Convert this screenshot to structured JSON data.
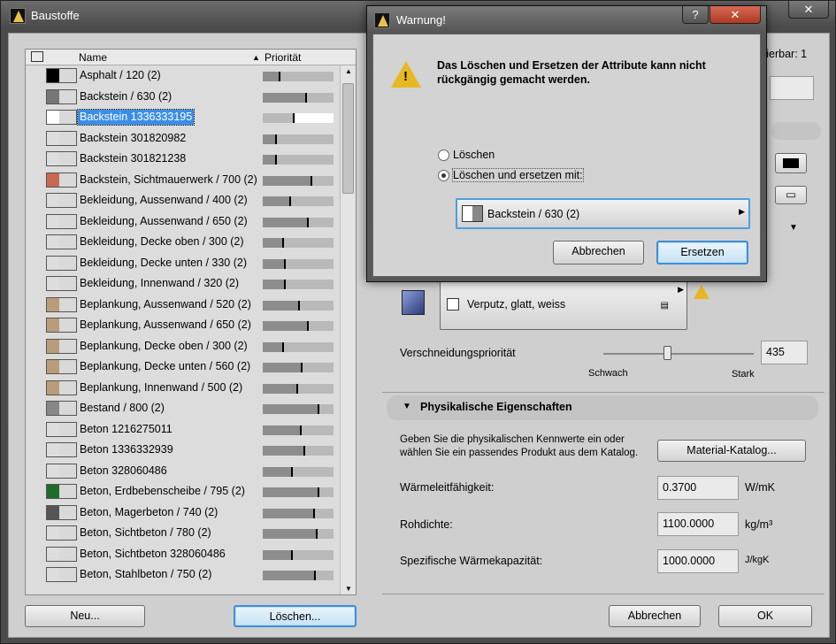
{
  "window": {
    "title": "Baustoffe"
  },
  "list": {
    "header_name": "Name",
    "header_priority": "Priorität",
    "items": [
      {
        "label": "Asphalt / 120 (2)",
        "priority": 0.25,
        "swatch": "#000"
      },
      {
        "label": "Backstein / 630 (2)",
        "priority": 0.63,
        "swatch": "#777"
      },
      {
        "label": "Backstein 1336333195",
        "priority": 0.45,
        "swatch": "#fff",
        "selected": true
      },
      {
        "label": "Backstein 301820982",
        "priority": 0.2,
        "swatch": "#ddd"
      },
      {
        "label": "Backstein 301821238",
        "priority": 0.2,
        "swatch": "#ddd"
      },
      {
        "label": "Backstein, Sichtmauerwerk / 700 (2)",
        "priority": 0.7,
        "swatch": "#c86a52"
      },
      {
        "label": "Bekleidung, Aussenwand / 400 (2)",
        "priority": 0.4,
        "swatch": "#ddd"
      },
      {
        "label": "Bekleidung, Aussenwand / 650 (2)",
        "priority": 0.65,
        "swatch": "#ddd"
      },
      {
        "label": "Bekleidung, Decke oben / 300 (2)",
        "priority": 0.3,
        "swatch": "#ddd"
      },
      {
        "label": "Bekleidung, Decke unten / 330 (2)",
        "priority": 0.33,
        "swatch": "#ddd"
      },
      {
        "label": "Bekleidung, Innenwand / 320 (2)",
        "priority": 0.32,
        "swatch": "#ddd"
      },
      {
        "label": "Beplankung, Aussenwand / 520 (2)",
        "priority": 0.52,
        "swatch": "#b99d7a"
      },
      {
        "label": "Beplankung, Aussenwand / 650 (2)",
        "priority": 0.65,
        "swatch": "#b99d7a"
      },
      {
        "label": "Beplankung, Decke oben / 300 (2)",
        "priority": 0.3,
        "swatch": "#b99d7a"
      },
      {
        "label": "Beplankung, Decke unten / 560 (2)",
        "priority": 0.56,
        "swatch": "#b99d7a"
      },
      {
        "label": "Beplankung, Innenwand / 500 (2)",
        "priority": 0.5,
        "swatch": "#b99d7a"
      },
      {
        "label": "Bestand / 800 (2)",
        "priority": 0.8,
        "swatch": "#888"
      },
      {
        "label": "Beton 1216275011",
        "priority": 0.55,
        "swatch": "#ddd"
      },
      {
        "label": "Beton 1336332939",
        "priority": 0.6,
        "swatch": "#ddd"
      },
      {
        "label": "Beton 328060486",
        "priority": 0.42,
        "swatch": "#ddd"
      },
      {
        "label": "Beton, Erdbebenscheibe / 795 (2)",
        "priority": 0.8,
        "swatch": "#1f6b2a"
      },
      {
        "label": "Beton, Magerbeton / 740 (2)",
        "priority": 0.74,
        "swatch": "#555"
      },
      {
        "label": "Beton, Sichtbeton / 780 (2)",
        "priority": 0.78,
        "swatch": "#ddd"
      },
      {
        "label": "Beton, Sichtbeton 328060486",
        "priority": 0.42,
        "swatch": "#ddd"
      },
      {
        "label": "Beton, Stahlbeton / 750 (2)",
        "priority": 0.75,
        "swatch": "#ddd"
      }
    ]
  },
  "buttons": {
    "new": "Neu...",
    "delete": "Löschen...",
    "cancel": "Abbrechen",
    "ok": "OK"
  },
  "right": {
    "editable_count": "itierbar: 1",
    "surface_label": "Verputz, glatt, weiss",
    "intersection_label": "Verschneidungspriorität",
    "intersection_value": "435",
    "slider_weak": "Schwach",
    "slider_strong": "Stark",
    "physical_header": "Physikalische Eigenschaften",
    "physical_text": "Geben Sie die physikalischen Kennwerte ein oder wählen Sie ein passendes Produkt aus dem Katalog.",
    "catalog_button": "Material-Katalog...",
    "conductivity_label": "Wärmeleitfähigkeit:",
    "conductivity_value": "0.3700",
    "conductivity_unit": "W/mK",
    "density_label": "Rohdichte:",
    "density_value": "1100.0000",
    "density_unit": "kg/m³",
    "capacity_label": "Spezifische Wärmekapazität:",
    "capacity_value": "1000.0000",
    "capacity_unit": "J/kgK"
  },
  "dialog": {
    "title": "Warnung!",
    "message_line1": "Das Löschen und Ersetzen der Attribute kann nicht",
    "message_line2": "rückgängig gemacht werden.",
    "option_delete": "Löschen",
    "option_replace": "Löschen und ersetzen mit:",
    "replacement": "Backstein / 630 (2)",
    "cancel": "Abbrechen",
    "replace": "Ersetzen",
    "help": "?",
    "close": "✕"
  }
}
